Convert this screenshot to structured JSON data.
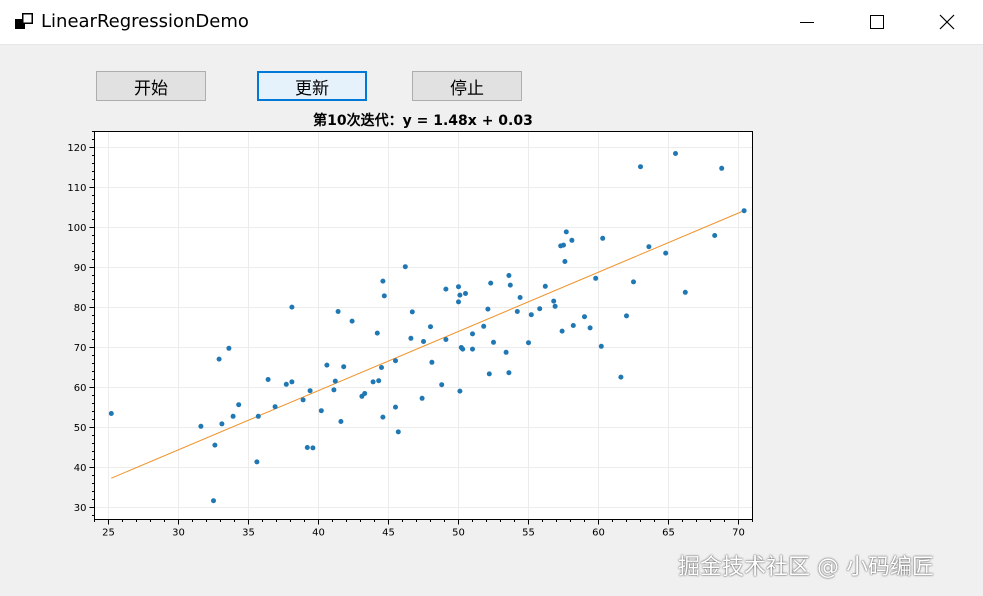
{
  "window": {
    "title": "LinearRegressionDemo"
  },
  "toolbar": {
    "start_label": "开始",
    "update_label": "更新",
    "stop_label": "停止"
  },
  "plot": {
    "title": "第10次迭代：y = 1.48x + 0.03"
  },
  "watermark": "掘金技术社区 @ 小码编匠",
  "colors": {
    "points": "#1f77b4",
    "line": "#f0932b",
    "focus": "#0078d7"
  },
  "chart_data": {
    "type": "scatter",
    "title": "第10次迭代：y = 1.48x + 0.03",
    "xlabel": "",
    "ylabel": "",
    "xlim": [
      24,
      71
    ],
    "ylim": [
      27,
      124
    ],
    "xticks": [
      25,
      30,
      35,
      40,
      45,
      50,
      55,
      60,
      65,
      70
    ],
    "yticks": [
      30,
      40,
      50,
      60,
      70,
      80,
      90,
      100,
      110,
      120
    ],
    "grid": true,
    "fit_line": {
      "slope": 1.48,
      "intercept": 0.03,
      "x_range": [
        25.2,
        70.4
      ]
    },
    "points": [
      [
        25.2,
        53.5
      ],
      [
        31.6,
        50.3
      ],
      [
        32.5,
        31.7
      ],
      [
        32.6,
        45.6
      ],
      [
        32.9,
        67.1
      ],
      [
        33.1,
        50.9
      ],
      [
        33.6,
        69.8
      ],
      [
        33.9,
        52.8
      ],
      [
        34.3,
        55.7
      ],
      [
        35.6,
        41.4
      ],
      [
        35.7,
        52.8
      ],
      [
        36.4,
        62.0
      ],
      [
        36.9,
        55.2
      ],
      [
        37.7,
        60.8
      ],
      [
        38.1,
        61.4
      ],
      [
        38.1,
        80.1
      ],
      [
        38.9,
        56.9
      ],
      [
        39.2,
        45.0
      ],
      [
        39.4,
        59.2
      ],
      [
        39.6,
        44.9
      ],
      [
        40.2,
        54.2
      ],
      [
        40.6,
        65.6
      ],
      [
        41.1,
        59.4
      ],
      [
        41.2,
        61.6
      ],
      [
        41.4,
        79.0
      ],
      [
        41.6,
        51.5
      ],
      [
        41.8,
        65.2
      ],
      [
        42.4,
        76.6
      ],
      [
        43.1,
        57.8
      ],
      [
        43.3,
        58.5
      ],
      [
        43.9,
        61.4
      ],
      [
        44.2,
        73.6
      ],
      [
        44.3,
        61.7
      ],
      [
        44.5,
        65.0
      ],
      [
        44.6,
        52.6
      ],
      [
        44.6,
        86.6
      ],
      [
        44.7,
        82.9
      ],
      [
        45.5,
        55.1
      ],
      [
        45.5,
        66.7
      ],
      [
        45.7,
        48.9
      ],
      [
        46.2,
        90.2
      ],
      [
        46.6,
        72.3
      ],
      [
        46.7,
        78.9
      ],
      [
        47.4,
        57.3
      ],
      [
        47.5,
        71.5
      ],
      [
        48.0,
        75.2
      ],
      [
        48.1,
        66.3
      ],
      [
        48.8,
        60.7
      ],
      [
        49.1,
        84.6
      ],
      [
        49.1,
        72.0
      ],
      [
        50.0,
        81.4
      ],
      [
        50.0,
        85.2
      ],
      [
        50.1,
        59.1
      ],
      [
        50.1,
        83.1
      ],
      [
        50.2,
        70.0
      ],
      [
        50.3,
        69.6
      ],
      [
        50.5,
        83.5
      ],
      [
        51.0,
        73.4
      ],
      [
        51.0,
        69.6
      ],
      [
        51.8,
        75.3
      ],
      [
        52.1,
        79.6
      ],
      [
        52.2,
        63.4
      ],
      [
        52.3,
        86.1
      ],
      [
        52.5,
        71.3
      ],
      [
        53.4,
        68.8
      ],
      [
        53.6,
        88.0
      ],
      [
        53.6,
        63.7
      ],
      [
        53.7,
        85.6
      ],
      [
        54.2,
        79.0
      ],
      [
        54.4,
        82.5
      ],
      [
        55.0,
        71.2
      ],
      [
        55.2,
        78.2
      ],
      [
        55.8,
        79.7
      ],
      [
        56.2,
        85.3
      ],
      [
        56.8,
        81.6
      ],
      [
        56.9,
        80.3
      ],
      [
        57.3,
        95.4
      ],
      [
        57.4,
        74.1
      ],
      [
        57.5,
        95.6
      ],
      [
        57.6,
        91.5
      ],
      [
        57.7,
        98.9
      ],
      [
        58.1,
        96.8
      ],
      [
        58.2,
        75.5
      ],
      [
        59.0,
        77.7
      ],
      [
        59.4,
        74.9
      ],
      [
        59.8,
        87.3
      ],
      [
        60.2,
        70.3
      ],
      [
        60.3,
        97.3
      ],
      [
        61.6,
        62.6
      ],
      [
        62.0,
        77.9
      ],
      [
        62.5,
        86.4
      ],
      [
        63.0,
        115.2
      ],
      [
        63.6,
        95.2
      ],
      [
        64.8,
        93.6
      ],
      [
        65.5,
        118.5
      ],
      [
        66.2,
        83.8
      ],
      [
        68.3,
        98.0
      ],
      [
        68.8,
        114.8
      ],
      [
        70.4,
        104.2
      ]
    ]
  }
}
